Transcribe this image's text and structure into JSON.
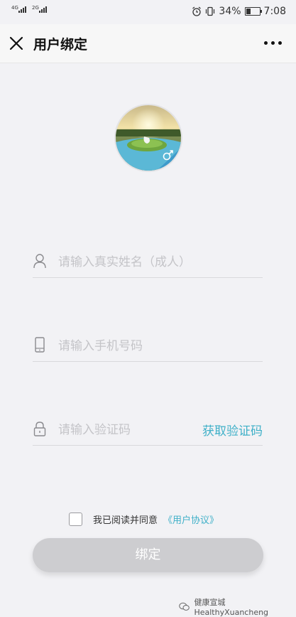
{
  "status_bar": {
    "network1": "4G",
    "network2": "2G",
    "battery_text": "34%",
    "battery_level": 0.34,
    "time": "7:08"
  },
  "nav": {
    "title": "用户绑定"
  },
  "form": {
    "name_placeholder": "请输入真实姓名（成人）",
    "phone_placeholder": "请输入手机号码",
    "code_placeholder": "请输入验证码",
    "get_code_label": "获取验证码"
  },
  "agreement": {
    "text": "我已阅读并同意",
    "link": "《用户协议》"
  },
  "submit_label": "绑定",
  "watermark": "健康宣城HealthyXuancheng",
  "colors": {
    "accent": "#3fb0c8",
    "button_disabled": "#cdcdd0",
    "background": "#f2f2f5"
  }
}
